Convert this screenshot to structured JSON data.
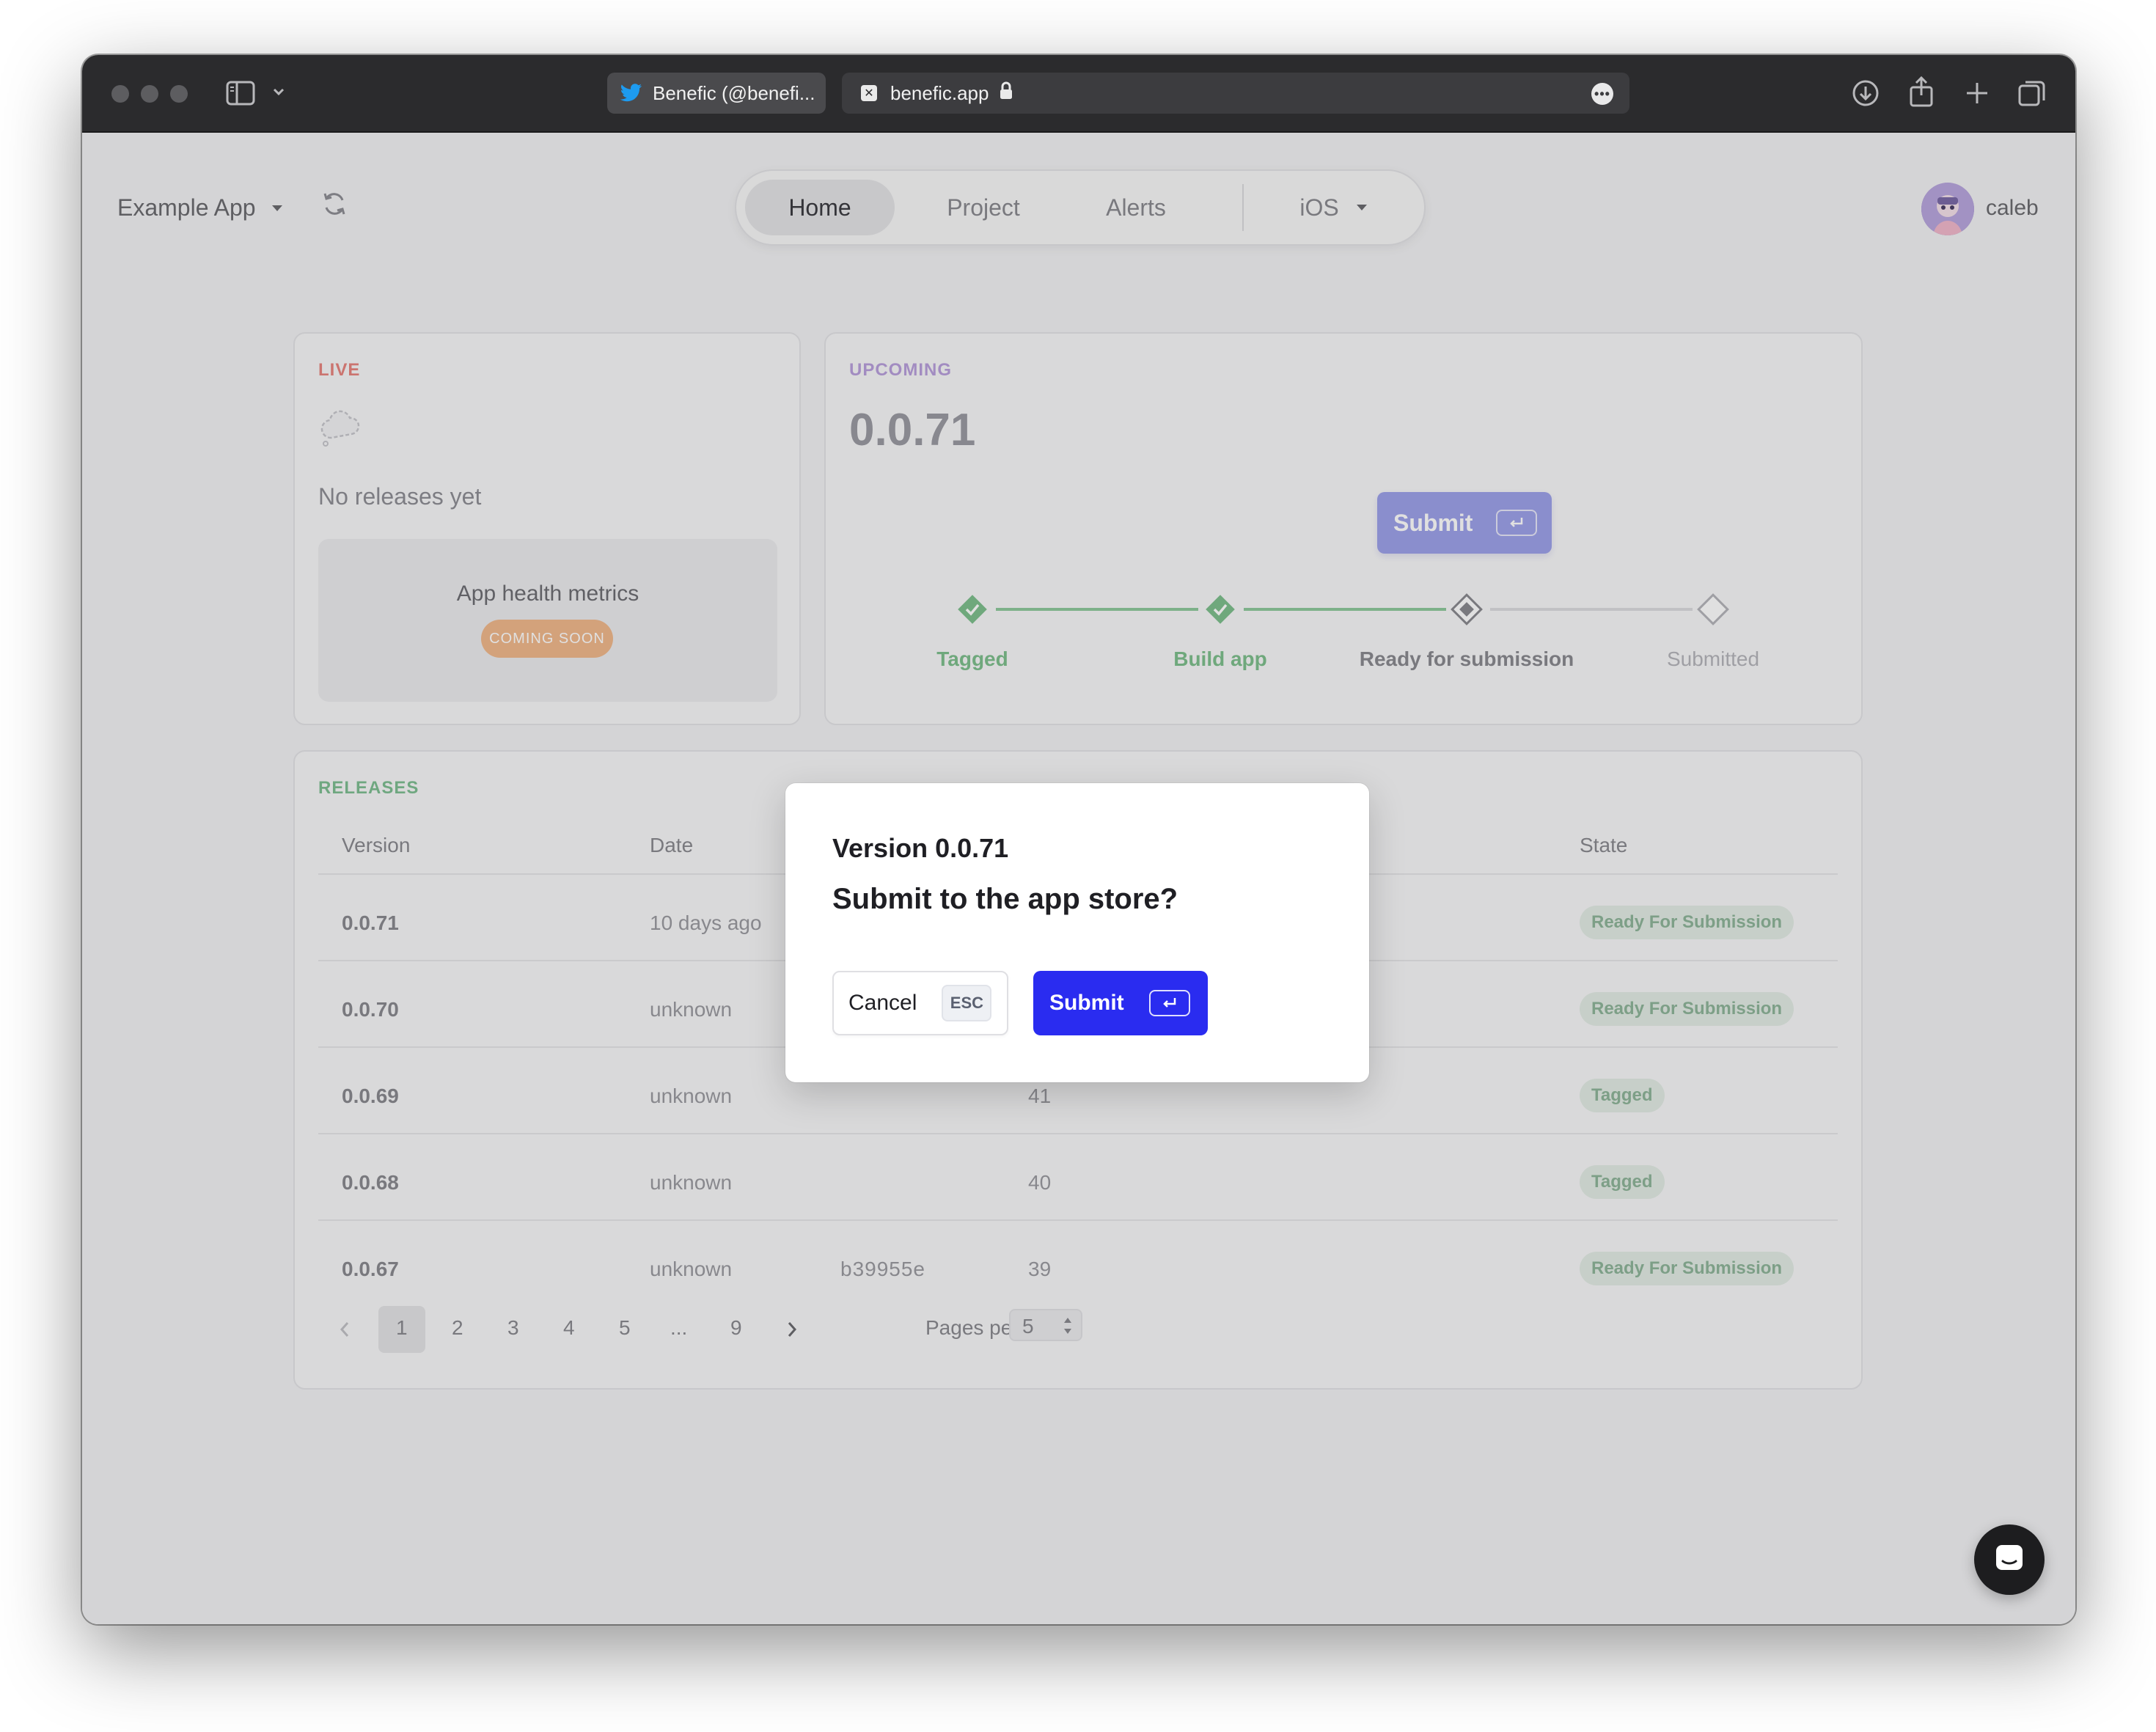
{
  "browser": {
    "tabs": [
      {
        "title": "Benefic (@benefi..."
      },
      {
        "title": "benefic.app"
      }
    ]
  },
  "header": {
    "app_name": "Example App",
    "nav": [
      "Home",
      "Project",
      "Alerts",
      "iOS"
    ],
    "active_nav": "Home",
    "user_name": "caleb"
  },
  "live": {
    "label": "LIVE",
    "empty_text": "No releases yet",
    "metrics_title": "App health metrics",
    "metrics_badge": "COMING SOON"
  },
  "upcoming": {
    "label": "UPCOMING",
    "version": "0.0.71",
    "submit_label": "Submit",
    "steps": [
      {
        "label": "Tagged",
        "status": "done"
      },
      {
        "label": "Build app",
        "status": "done"
      },
      {
        "label": "Ready for submission",
        "status": "current"
      },
      {
        "label": "Submitted",
        "status": "pending"
      }
    ]
  },
  "releases": {
    "label": "RELEASES",
    "columns": [
      "Version",
      "Date",
      "State"
    ],
    "rows": [
      {
        "version": "0.0.71",
        "date": "10 days ago",
        "commit": "",
        "build": "",
        "state": "Ready For Submission"
      },
      {
        "version": "0.0.70",
        "date": "unknown",
        "commit": "",
        "build": "",
        "state": "Ready For Submission"
      },
      {
        "version": "0.0.69",
        "date": "unknown",
        "commit": "",
        "build": "41",
        "state": "Tagged"
      },
      {
        "version": "0.0.68",
        "date": "unknown",
        "commit": "",
        "build": "40",
        "state": "Tagged"
      },
      {
        "version": "0.0.67",
        "date": "unknown",
        "commit": "b39955e",
        "build": "39",
        "state": "Ready For Submission"
      }
    ],
    "pagination": {
      "pages": [
        "1",
        "2",
        "3",
        "4",
        "5",
        "...",
        "9"
      ],
      "current": "1",
      "per_page_label": "Pages per row",
      "per_page_value": "5"
    }
  },
  "modal": {
    "title": "Version 0.0.71",
    "question": "Submit to the app store?",
    "cancel_label": "Cancel",
    "cancel_key": "ESC",
    "submit_label": "Submit"
  },
  "colors": {
    "live": "#e7857f",
    "upcoming": "#b9a0dc",
    "releases": "#7fbf92",
    "step_done": "#7fc08e",
    "submit_primary": "#2a2cf0",
    "submit_disabled": "#9ea2ea",
    "coming_soon": "#f1b98d"
  },
  "icons": {
    "sidebar": "sidebar-toggle-icon",
    "refresh": "refresh-icon",
    "download": "download-icon",
    "share": "share-icon",
    "new_tab": "plus-icon",
    "tabs_overview": "tabs-overview-icon",
    "chat": "chat-icon",
    "enter": "enter-key-icon"
  }
}
